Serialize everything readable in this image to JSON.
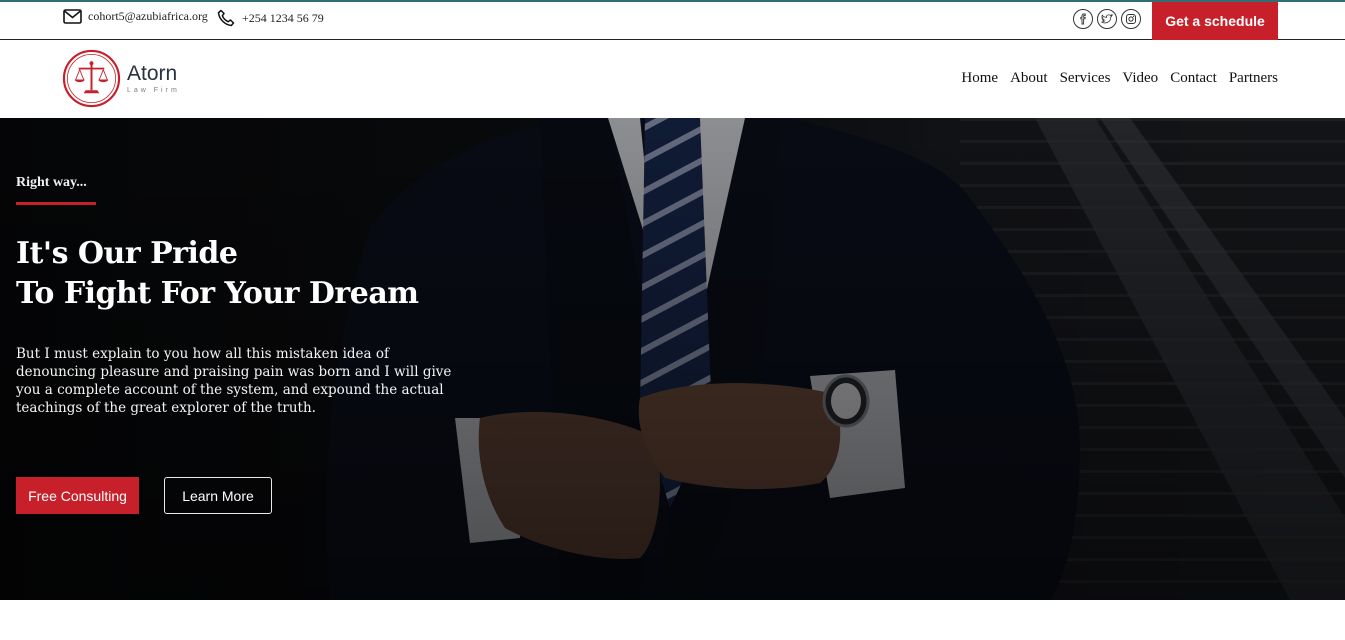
{
  "topbar": {
    "email": "cohort5@azubiafrica.org",
    "phone": "+254 1234 56 79",
    "email_icon": "mail-icon",
    "phone_icon": "phone-icon",
    "socials": [
      "facebook-icon",
      "twitter-icon",
      "instagram-icon"
    ],
    "schedule_label": "Get a schedule"
  },
  "logo": {
    "name": "Atorn",
    "tagline": "Law Firm",
    "icon": "scales-of-justice-icon"
  },
  "nav": {
    "items": [
      "Home",
      "About",
      "Services",
      "Video",
      "Contact",
      "Partners"
    ]
  },
  "hero": {
    "eyebrow": "Right way...",
    "headline_line1": "It's Our Pride",
    "headline_line2": "To Fight For Your Dream",
    "description": "But I must explain to you how all this mistaken idea of denouncing pleasure and praising pain was born and I will give you a complete account of the system, and expound the actual teachings of the great explorer of the truth.",
    "primary_button": "Free Consulting",
    "secondary_button": "Learn More"
  },
  "colors": {
    "accent": "#c8202a",
    "top_border": "#2f6f73",
    "hero_bg": "#0c0d10"
  }
}
